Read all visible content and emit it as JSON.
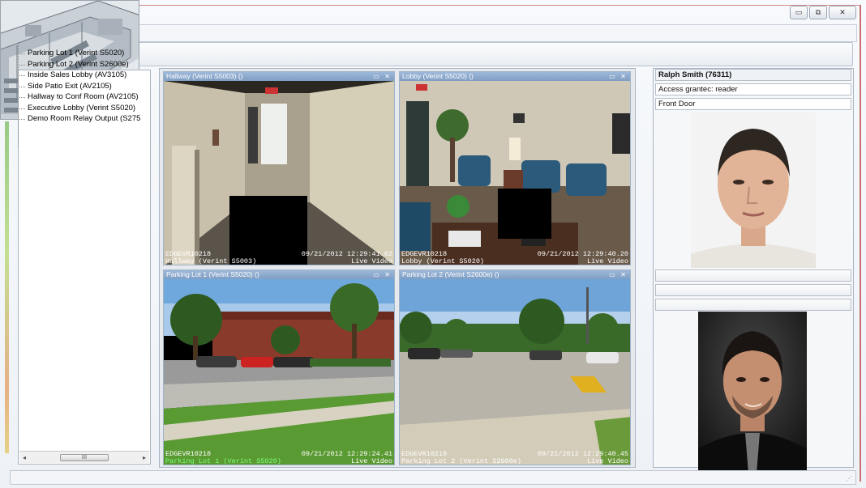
{
  "window": {
    "controls": {
      "minimize": "▭",
      "restore": "⧉",
      "close": "✕"
    }
  },
  "tree": {
    "items": [
      "Parking Lot 1 (Verint S5020)",
      "Parking Lot 2 (Verint S2600e)",
      "Inside Sales Lobby (AV3105)",
      "Side Patio Exit (AV2105)",
      "Hallway to Conf Room (AV2105)",
      "Executive Lobby (Verint S5020)",
      "Demo Room Relay Output (S275"
    ],
    "scroll_thumb": "III",
    "scroll_left": "◂",
    "scroll_right": "▸"
  },
  "tiles": [
    {
      "title": "Hallway (Verint S5003) ()",
      "device": "EDGEVR10218",
      "timestamp": "09/21/2012 12:29:41.62",
      "label": "Hallway (Verint S5003)",
      "mode": "Live Video",
      "label_color": "white"
    },
    {
      "title": "Lobby (Verint S5020) ()",
      "device": "EDGEVR10218",
      "timestamp": "09/21/2012 12:29:40.20",
      "label": "Lobby (Verint S5020)",
      "mode": "Live Video",
      "label_color": "white"
    },
    {
      "title": "Parking Lot 1 (Verint S5020) ()",
      "device": "EDGEVR10218",
      "timestamp": "09/21/2012 12:29:24.41",
      "label": "Parking Lot 1 (Verint S5020)",
      "mode": "Live Video",
      "label_color": "green"
    },
    {
      "title": "Parking Lot 2 (Verint S2600e) ()",
      "device": "EDGEVR10218",
      "timestamp": "09/21/2012 12:29:40.45",
      "label": "Parking Lot 2 (Verint S2600e)",
      "mode": "Live Video",
      "label_color": "white"
    }
  ],
  "tile_buttons": "▭ ✕",
  "info": {
    "name": "Ralph Smith (76311)",
    "access": "Access grantec: reader",
    "door": "Front Door"
  },
  "status": {
    "grip": "⋰"
  },
  "colors": {
    "title_bar": "#8fabd0",
    "panel_border": "#a9b4c2",
    "osd_green": "#7dff7d"
  }
}
